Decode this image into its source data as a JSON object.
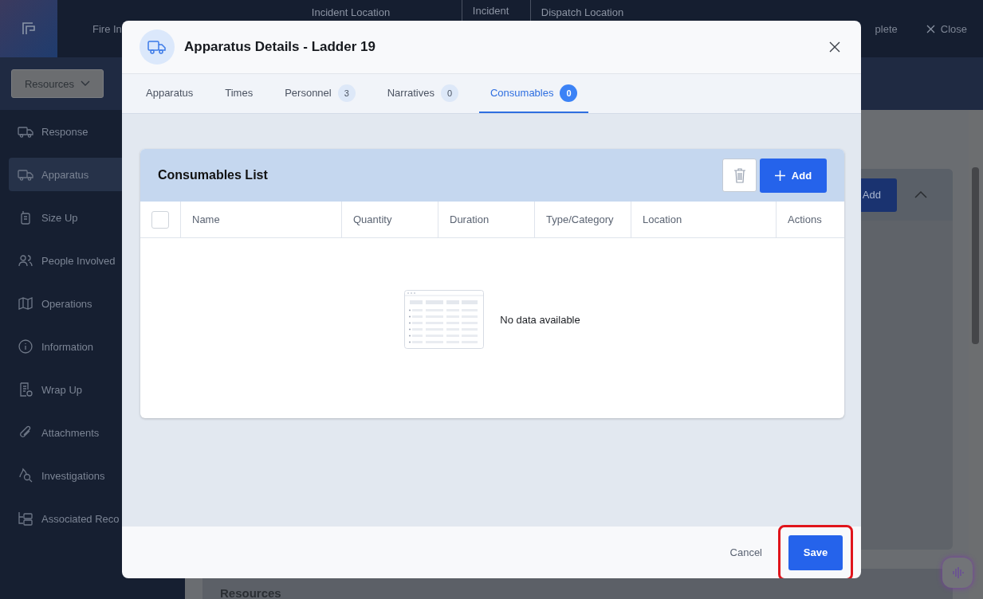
{
  "app_header": {
    "title": "Fire In",
    "fields": [
      "Incident Location",
      "Incident",
      "Dispatch Location"
    ],
    "actions": [
      {
        "kind": "text",
        "label": "plete"
      },
      {
        "kind": "close",
        "label": "Close"
      }
    ]
  },
  "toolbar": {
    "dropdown": "Resources"
  },
  "sidebar": {
    "items": [
      {
        "label": "Response",
        "selected": false
      },
      {
        "label": "Apparatus",
        "selected": true
      },
      {
        "label": "Size Up",
        "selected": false
      },
      {
        "label": "People Involved",
        "selected": false
      },
      {
        "label": "Operations",
        "selected": false
      },
      {
        "label": "Information",
        "selected": false
      },
      {
        "label": "Wrap Up",
        "selected": false
      },
      {
        "label": "Attachments",
        "selected": false
      },
      {
        "label": "Investigations",
        "selected": false
      },
      {
        "label": "Associated Reco",
        "selected": false
      }
    ]
  },
  "background_panel": {
    "add_button": "Add",
    "section_title": "Resources"
  },
  "dialog": {
    "title": "Apparatus Details - Ladder 19",
    "tabs": [
      {
        "label": "Apparatus",
        "selected": false
      },
      {
        "label": "Times",
        "selected": false
      },
      {
        "label": "Personnel",
        "count": "3",
        "selected": false
      },
      {
        "label": "Narratives",
        "count": "0",
        "selected": false
      },
      {
        "label": "Consumables",
        "count": "0",
        "selected": true
      }
    ],
    "list": {
      "title": "Consumables List",
      "add_button": "Add",
      "select_all_checked": false,
      "columns": [
        "Name",
        "Quantity",
        "Duration",
        "Type/Category",
        "Location",
        "Actions"
      ],
      "empty_text": "No data available"
    },
    "footer": {
      "cancel": "Cancel",
      "save": "Save",
      "save_highlighted": true
    }
  }
}
